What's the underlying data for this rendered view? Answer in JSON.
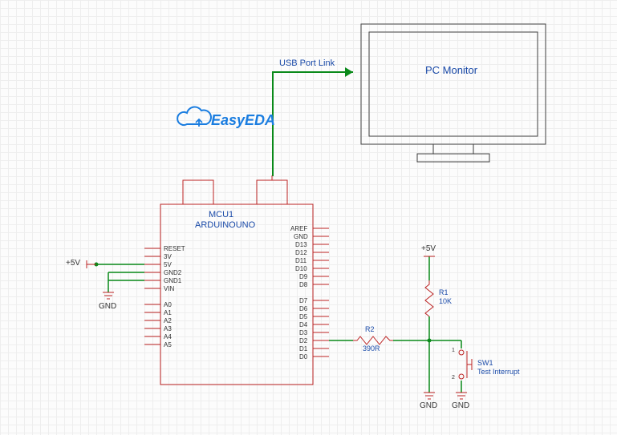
{
  "brand": "EasyEDA",
  "link_label": "USB Port Link",
  "pc_monitor_label": "PC Monitor",
  "mcu": {
    "ref": "MCU1",
    "part": "ARDUINOUNO",
    "left_pins": [
      "RESET",
      "3V",
      "5V",
      "GND2",
      "GND1",
      "VIN",
      "A0",
      "A1",
      "A2",
      "A3",
      "A4",
      "A5"
    ],
    "right_pins": [
      "AREF",
      "GND",
      "D13",
      "D12",
      "D11",
      "D10",
      "D9",
      "D8",
      "D7",
      "D6",
      "D5",
      "D4",
      "D3",
      "D2",
      "D1",
      "D0"
    ]
  },
  "nets": {
    "p5v_left": "+5V",
    "gnd_left": "GND",
    "p5v_right": "+5V",
    "gnd_r1": "GND",
    "gnd_r2": "GND"
  },
  "r1": {
    "ref": "R1",
    "value": "10K"
  },
  "r2": {
    "ref": "R2",
    "value": "390R"
  },
  "sw1": {
    "ref": "SW1",
    "value": "Test Interrupt"
  }
}
